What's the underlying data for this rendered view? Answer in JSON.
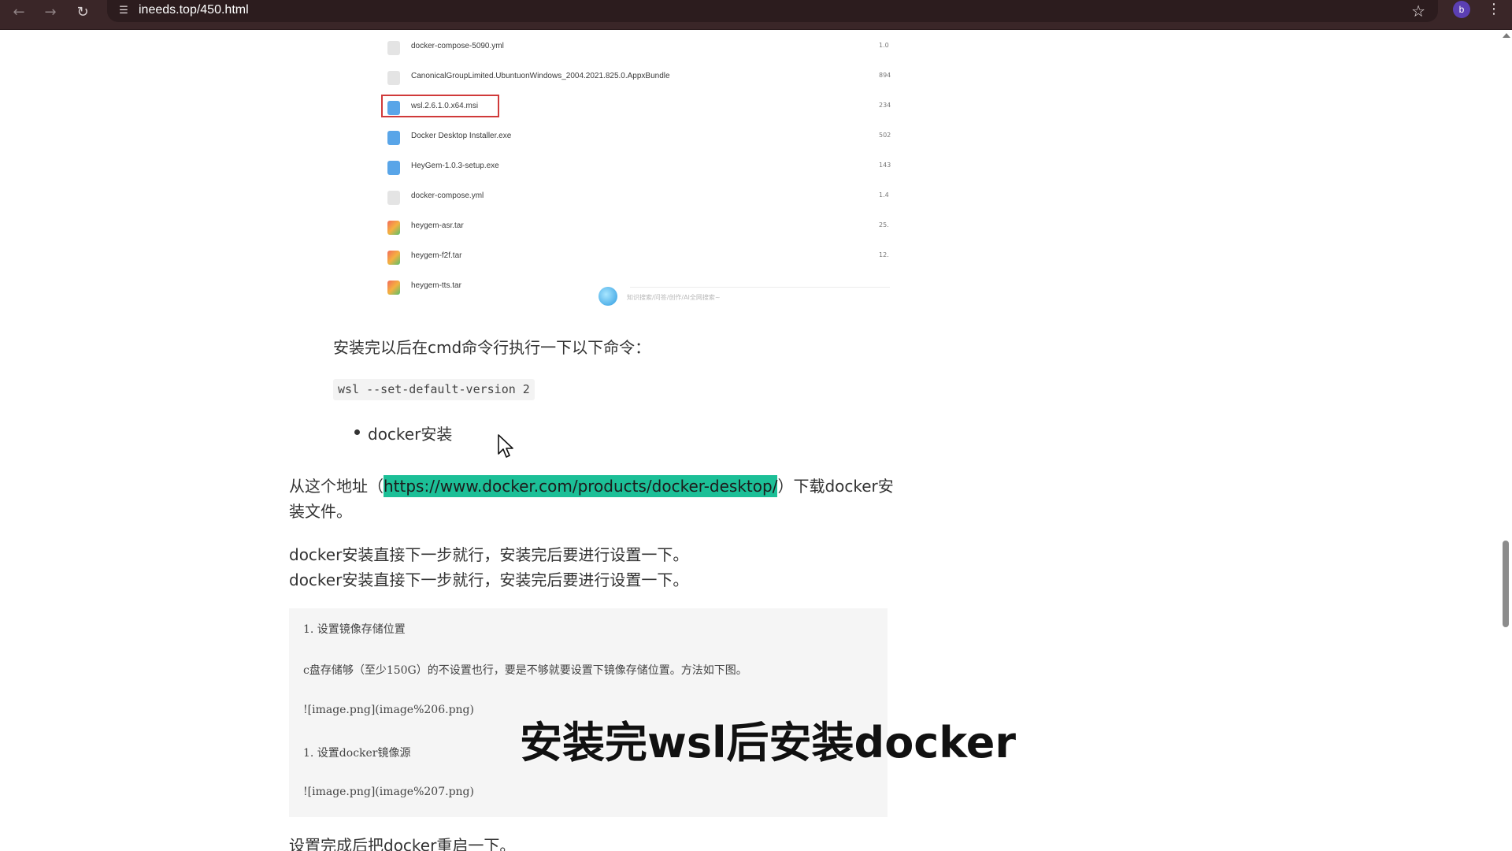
{
  "browser": {
    "url": "ineeds.top/450.html",
    "profile_initial": "b",
    "icons": {
      "back": "arrow-left-icon",
      "forward": "arrow-right-icon",
      "reload": "reload-icon",
      "site_info": "tune-icon",
      "bookmark": "star-icon",
      "menu": "kebab-icon"
    }
  },
  "file_list": {
    "files": [
      {
        "name": "docker-compose-5090.yml",
        "size": "1.0",
        "icon": "doc"
      },
      {
        "name": "CanonicalGroupLimited.UbuntuonWindows_2004.2021.825.0.AppxBundle",
        "size": "894",
        "icon": "doc"
      },
      {
        "name": "wsl.2.6.1.0.x64.msi",
        "size": "234",
        "icon": "inst",
        "highlighted": true
      },
      {
        "name": "Docker Desktop Installer.exe",
        "size": "502",
        "icon": "inst"
      },
      {
        "name": "HeyGem-1.0.3-setup.exe",
        "size": "143",
        "icon": "inst"
      },
      {
        "name": "docker-compose.yml",
        "size": "1.4",
        "icon": "doc"
      },
      {
        "name": "heygem-asr.tar",
        "size": "25.",
        "icon": "arch"
      },
      {
        "name": "heygem-f2f.tar",
        "size": "12.",
        "icon": "arch"
      },
      {
        "name": "heygem-tts.tar",
        "size": "",
        "icon": "arch"
      }
    ],
    "watermark_text": "知识搜索/问答/创作/AI全网搜索~"
  },
  "article": {
    "install_cmd_intro": "安装完以后在cmd命令行执行一下以下命令：",
    "inline_code": "wsl --set-default-version 2",
    "bullet_docker": "docker安装",
    "url_prefix": "从这个地址（",
    "url_link": "https://www.docker.com/products/docker-desktop/",
    "url_suffix": "）下载docker安",
    "url_line2": "装文件。",
    "step_line1": "docker安装直接下一步就行，安装完后要进行设置一下。",
    "step_line2": "docker安装直接下一步就行，安装完后要进行设置一下。",
    "code_block": [
      "1. 设置镜像存储位置",
      "c盘存储够（至少150G）的不设置也行，要是不够就要设置下镜像存储位置。方法如下图。",
      "![image.png](image%206.png)",
      "1. 设置docker镜像源",
      "![image.png](image%207.png)"
    ],
    "restart": "设置完成后把docker重启一下。"
  },
  "caption": "安装完wsl后安装docker"
}
